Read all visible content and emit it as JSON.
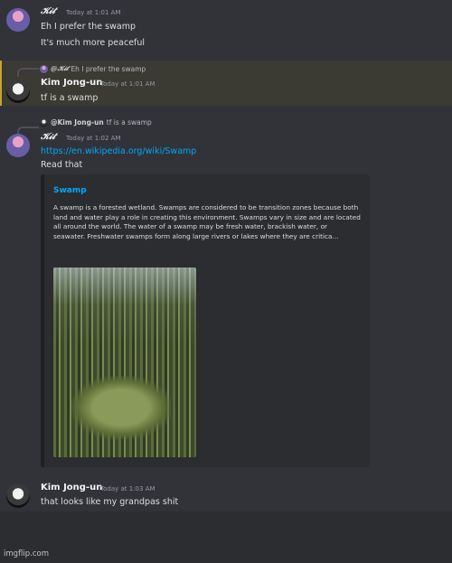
{
  "messages": [
    {
      "author": "𝒦𝒾𝓉",
      "timestamp": "Today at 1:01 AM",
      "lines": [
        "Eh I prefer the swamp",
        "It's much more peaceful"
      ]
    },
    {
      "reply_to_author": "@𝒦𝒾𝓉",
      "reply_to_text": "Eh I prefer the swamp",
      "author": "Kim Jong-un",
      "timestamp": "Today at 1:01 AM",
      "lines": [
        "tf is a swamp"
      ]
    },
    {
      "reply_to_author": "@Kim Jong-un",
      "reply_to_text": "tf is a swamp",
      "author": "𝒦𝒾𝓉",
      "timestamp": "Today at 1:02 AM",
      "link": "https://en.wikipedia.org/wiki/Swamp",
      "lines": [
        "Read that"
      ],
      "embed": {
        "title": "Swamp",
        "description": "A swamp is a forested wetland. Swamps are considered to be transition zones because both land and water play a role in creating this environment. Swamps vary in size and are located all around the world. The water of a swamp may be fresh water, brackish water, or seawater. Freshwater swamps form along large rivers or lakes where they are critica..."
      }
    },
    {
      "author": "Kim Jong-un",
      "timestamp": "Today at 1:03 AM",
      "lines": [
        "that looks like my grandpas shit"
      ]
    }
  ],
  "watermark": "imgflip.com",
  "colors": {
    "link": "#00a8fc",
    "highlight_bar": "#c9a32f",
    "background": "#313338"
  }
}
